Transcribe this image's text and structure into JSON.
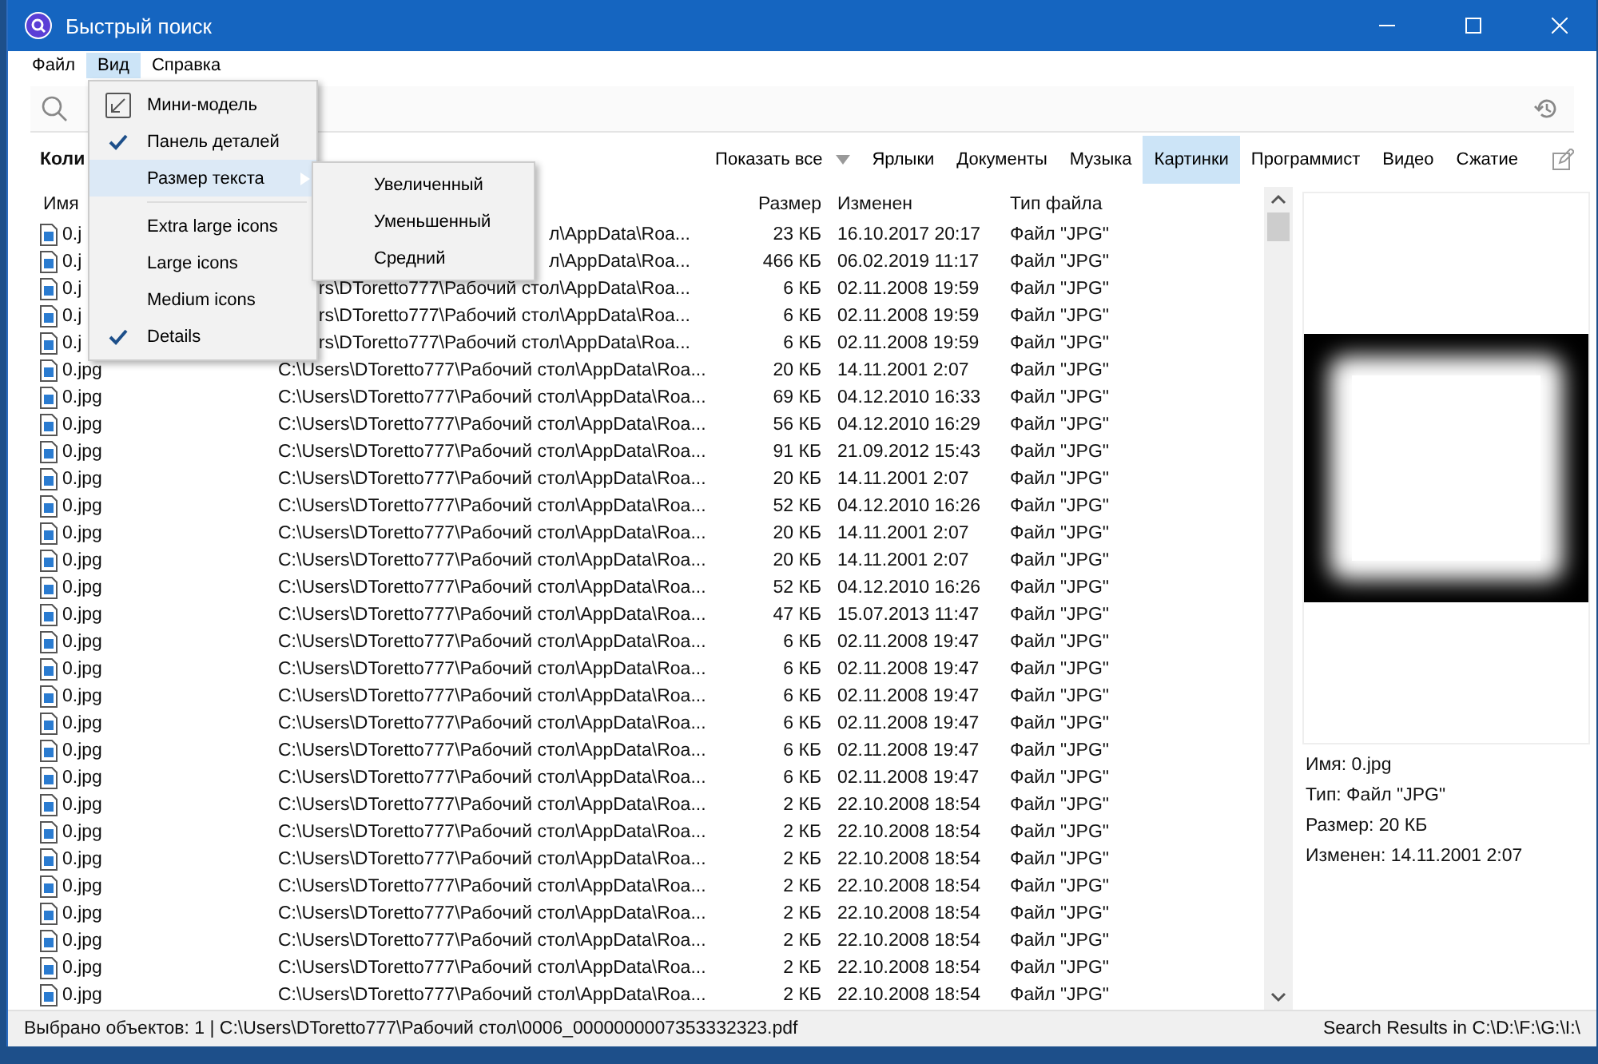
{
  "window": {
    "title": "Быстрый поиск"
  },
  "menubar": [
    {
      "label": "Файл",
      "selected": false
    },
    {
      "label": "Вид",
      "selected": true
    },
    {
      "label": "Справка",
      "selected": false
    }
  ],
  "view_menu": [
    {
      "kind": "icon",
      "label": "Мини-модель",
      "checked": false,
      "selected": false
    },
    {
      "kind": "option",
      "label": "Панель деталей",
      "checked": true,
      "selected": false
    },
    {
      "kind": "submenu",
      "label": "Размер текста",
      "checked": false,
      "selected": true
    },
    {
      "kind": "separator"
    },
    {
      "kind": "option",
      "label": "Extra large icons",
      "checked": false,
      "selected": false
    },
    {
      "kind": "option",
      "label": "Large icons",
      "checked": false,
      "selected": false
    },
    {
      "kind": "option",
      "label": "Medium icons",
      "checked": false,
      "selected": false
    },
    {
      "kind": "option",
      "label": "Details",
      "checked": true,
      "selected": false
    }
  ],
  "text_size_submenu": [
    "Увеличенный",
    "Уменьшенный",
    "Средний"
  ],
  "results_label": "Коли",
  "filter_tabs": [
    {
      "label": "Показать все",
      "selected": false,
      "dropdown": true
    },
    {
      "label": "Ярлыки",
      "selected": false,
      "dropdown": false
    },
    {
      "label": "Документы",
      "selected": false,
      "dropdown": false
    },
    {
      "label": "Музыка",
      "selected": false,
      "dropdown": false
    },
    {
      "label": "Картинки",
      "selected": true,
      "dropdown": false
    },
    {
      "label": "Программист",
      "selected": false,
      "dropdown": false
    },
    {
      "label": "Видео",
      "selected": false,
      "dropdown": false
    },
    {
      "label": "Сжатие",
      "selected": false,
      "dropdown": false
    }
  ],
  "table": {
    "columns": [
      "Имя",
      "Размер",
      "Изменен",
      "Тип файла"
    ],
    "rows": [
      {
        "name": "0.j",
        "path": "л\\AppData\\Roa...",
        "size": "23 КБ",
        "modified": "16.10.2017 20:17",
        "type": "Файл \"JPG\""
      },
      {
        "name": "0.j",
        "path": "л\\AppData\\Roa...",
        "size": "466 КБ",
        "modified": "06.02.2019 11:17",
        "type": "Файл \"JPG\""
      },
      {
        "name": "0.j",
        "path": "rs\\DToretto777\\Рабочий стол\\AppData\\Roa...",
        "size": "6 КБ",
        "modified": "02.11.2008 19:59",
        "type": "Файл \"JPG\""
      },
      {
        "name": "0.j",
        "path": "rs\\DToretto777\\Рабочий стол\\AppData\\Roa...",
        "size": "6 КБ",
        "modified": "02.11.2008 19:59",
        "type": "Файл \"JPG\""
      },
      {
        "name": "0.j",
        "path": "rs\\DToretto777\\Рабочий стол\\AppData\\Roa...",
        "size": "6 КБ",
        "modified": "02.11.2008 19:59",
        "type": "Файл \"JPG\""
      },
      {
        "name": "0.jpg",
        "path": "C:\\Users\\DToretto777\\Рабочий стол\\AppData\\Roa...",
        "size": "20 КБ",
        "modified": "14.11.2001 2:07",
        "type": "Файл \"JPG\""
      },
      {
        "name": "0.jpg",
        "path": "C:\\Users\\DToretto777\\Рабочий стол\\AppData\\Roa...",
        "size": "69 КБ",
        "modified": "04.12.2010 16:33",
        "type": "Файл \"JPG\""
      },
      {
        "name": "0.jpg",
        "path": "C:\\Users\\DToretto777\\Рабочий стол\\AppData\\Roa...",
        "size": "56 КБ",
        "modified": "04.12.2010 16:29",
        "type": "Файл \"JPG\""
      },
      {
        "name": "0.jpg",
        "path": "C:\\Users\\DToretto777\\Рабочий стол\\AppData\\Roa...",
        "size": "91 КБ",
        "modified": "21.09.2012 15:43",
        "type": "Файл \"JPG\""
      },
      {
        "name": "0.jpg",
        "path": "C:\\Users\\DToretto777\\Рабочий стол\\AppData\\Roa...",
        "size": "20 КБ",
        "modified": "14.11.2001 2:07",
        "type": "Файл \"JPG\""
      },
      {
        "name": "0.jpg",
        "path": "C:\\Users\\DToretto777\\Рабочий стол\\AppData\\Roa...",
        "size": "52 КБ",
        "modified": "04.12.2010 16:26",
        "type": "Файл \"JPG\""
      },
      {
        "name": "0.jpg",
        "path": "C:\\Users\\DToretto777\\Рабочий стол\\AppData\\Roa...",
        "size": "20 КБ",
        "modified": "14.11.2001 2:07",
        "type": "Файл \"JPG\""
      },
      {
        "name": "0.jpg",
        "path": "C:\\Users\\DToretto777\\Рабочий стол\\AppData\\Roa...",
        "size": "20 КБ",
        "modified": "14.11.2001 2:07",
        "type": "Файл \"JPG\""
      },
      {
        "name": "0.jpg",
        "path": "C:\\Users\\DToretto777\\Рабочий стол\\AppData\\Roa...",
        "size": "52 КБ",
        "modified": "04.12.2010 16:26",
        "type": "Файл \"JPG\""
      },
      {
        "name": "0.jpg",
        "path": "C:\\Users\\DToretto777\\Рабочий стол\\AppData\\Roa...",
        "size": "47 КБ",
        "modified": "15.07.2013 11:47",
        "type": "Файл \"JPG\""
      },
      {
        "name": "0.jpg",
        "path": "C:\\Users\\DToretto777\\Рабочий стол\\AppData\\Roa...",
        "size": "6 КБ",
        "modified": "02.11.2008 19:47",
        "type": "Файл \"JPG\""
      },
      {
        "name": "0.jpg",
        "path": "C:\\Users\\DToretto777\\Рабочий стол\\AppData\\Roa...",
        "size": "6 КБ",
        "modified": "02.11.2008 19:47",
        "type": "Файл \"JPG\""
      },
      {
        "name": "0.jpg",
        "path": "C:\\Users\\DToretto777\\Рабочий стол\\AppData\\Roa...",
        "size": "6 КБ",
        "modified": "02.11.2008 19:47",
        "type": "Файл \"JPG\""
      },
      {
        "name": "0.jpg",
        "path": "C:\\Users\\DToretto777\\Рабочий стол\\AppData\\Roa...",
        "size": "6 КБ",
        "modified": "02.11.2008 19:47",
        "type": "Файл \"JPG\""
      },
      {
        "name": "0.jpg",
        "path": "C:\\Users\\DToretto777\\Рабочий стол\\AppData\\Roa...",
        "size": "6 КБ",
        "modified": "02.11.2008 19:47",
        "type": "Файл \"JPG\""
      },
      {
        "name": "0.jpg",
        "path": "C:\\Users\\DToretto777\\Рабочий стол\\AppData\\Roa...",
        "size": "6 КБ",
        "modified": "02.11.2008 19:47",
        "type": "Файл \"JPG\""
      },
      {
        "name": "0.jpg",
        "path": "C:\\Users\\DToretto777\\Рабочий стол\\AppData\\Roa...",
        "size": "2 КБ",
        "modified": "22.10.2008 18:54",
        "type": "Файл \"JPG\""
      },
      {
        "name": "0.jpg",
        "path": "C:\\Users\\DToretto777\\Рабочий стол\\AppData\\Roa...",
        "size": "2 КБ",
        "modified": "22.10.2008 18:54",
        "type": "Файл \"JPG\""
      },
      {
        "name": "0.jpg",
        "path": "C:\\Users\\DToretto777\\Рабочий стол\\AppData\\Roa...",
        "size": "2 КБ",
        "modified": "22.10.2008 18:54",
        "type": "Файл \"JPG\""
      },
      {
        "name": "0.jpg",
        "path": "C:\\Users\\DToretto777\\Рабочий стол\\AppData\\Roa...",
        "size": "2 КБ",
        "modified": "22.10.2008 18:54",
        "type": "Файл \"JPG\""
      },
      {
        "name": "0.jpg",
        "path": "C:\\Users\\DToretto777\\Рабочий стол\\AppData\\Roa...",
        "size": "2 КБ",
        "modified": "22.10.2008 18:54",
        "type": "Файл \"JPG\""
      },
      {
        "name": "0.jpg",
        "path": "C:\\Users\\DToretto777\\Рабочий стол\\AppData\\Roa...",
        "size": "2 КБ",
        "modified": "22.10.2008 18:54",
        "type": "Файл \"JPG\""
      },
      {
        "name": "0.jpg",
        "path": "C:\\Users\\DToretto777\\Рабочий стол\\AppData\\Roa...",
        "size": "2 КБ",
        "modified": "22.10.2008 18:54",
        "type": "Файл \"JPG\""
      },
      {
        "name": "0.jpg",
        "path": "C:\\Users\\DToretto777\\Рабочий стол\\AppData\\Roa...",
        "size": "2 КБ",
        "modified": "22.10.2008 18:54",
        "type": "Файл \"JPG\""
      }
    ]
  },
  "details_panel": {
    "lines": [
      "Имя: 0.jpg",
      "Тип: Файл \"JPG\"",
      "Размер: 20 КБ",
      "Изменен: 14.11.2001 2:07"
    ]
  },
  "status_bar": {
    "left": "Выбрано объектов: 1 | C:\\Users\\DToretto777\\Рабочий стол\\0006_0000000007353332323.pdf",
    "right": "Search Results in C:\\D:\\F:\\G:\\I:\\"
  }
}
